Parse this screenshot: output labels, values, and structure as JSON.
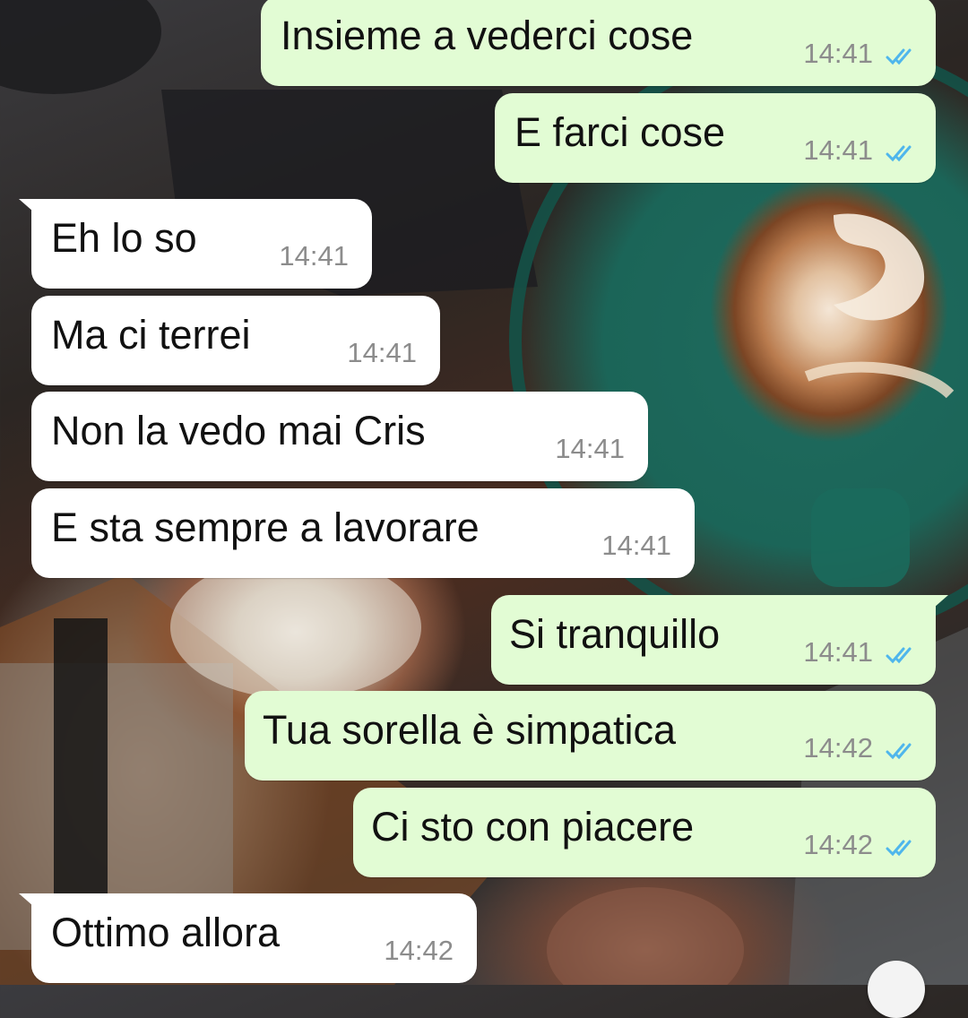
{
  "chat": {
    "messages": [
      {
        "direction": "outgoing",
        "text": "Insieme a vederci cose",
        "time": "14:41",
        "status": "read"
      },
      {
        "direction": "outgoing",
        "text": "E farci cose",
        "time": "14:41",
        "status": "read"
      },
      {
        "direction": "incoming",
        "text": "Eh lo so",
        "time": "14:41"
      },
      {
        "direction": "incoming",
        "text": "Ma ci terrei",
        "time": "14:41"
      },
      {
        "direction": "incoming",
        "text": "Non la vedo mai Cris",
        "time": "14:41"
      },
      {
        "direction": "incoming",
        "text": "E sta sempre a lavorare",
        "time": "14:41"
      },
      {
        "direction": "outgoing",
        "text": "Si tranquillo",
        "time": "14:41",
        "status": "read"
      },
      {
        "direction": "outgoing",
        "text": "Tua sorella è simpatica",
        "time": "14:42",
        "status": "read"
      },
      {
        "direction": "outgoing",
        "text": "Ci sto con piacere",
        "time": "14:42",
        "status": "read"
      },
      {
        "direction": "incoming",
        "text": "Ottimo allora",
        "time": "14:42"
      }
    ]
  },
  "colors": {
    "outgoing_bubble": "#e2fcd4",
    "incoming_bubble": "#ffffff",
    "read_tick": "#4fb6ec",
    "timestamp": "#8c8c8c"
  },
  "icons": {
    "read_receipt": "double-check-icon",
    "scroll_down": "scroll-down-button"
  }
}
